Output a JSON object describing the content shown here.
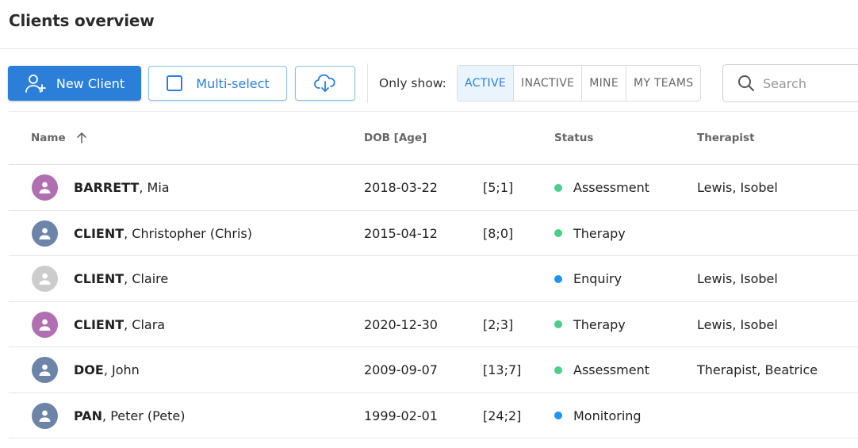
{
  "page": {
    "title": "Clients overview"
  },
  "toolbar": {
    "new_client_label": "New Client",
    "multi_select_label": "Multi-select",
    "only_show_label": "Only show:",
    "filters": [
      {
        "label": "ACTIVE",
        "active": true
      },
      {
        "label": "INACTIVE",
        "active": false
      },
      {
        "label": "MINE",
        "active": false
      },
      {
        "label": "MY TEAMS",
        "active": false
      }
    ],
    "search_placeholder": "Search"
  },
  "table": {
    "columns": {
      "name": "Name",
      "dob": "DOB [Age]",
      "status": "Status",
      "therapist": "Therapist"
    },
    "sort": {
      "column": "name",
      "direction": "ascending"
    },
    "rows": [
      {
        "surname": "BARRETT",
        "given": ", Mia",
        "dob": "2018-03-22",
        "age": "[5;1]",
        "status": "Assessment",
        "status_color": "#4cce8b",
        "therapist": "Lewis, Isobel",
        "avatar_color": "#b06fb0"
      },
      {
        "surname": "CLIENT",
        "given": ", Christopher (Chris)",
        "dob": "2015-04-12",
        "age": "[8;0]",
        "status": "Therapy",
        "status_color": "#4cce8b",
        "therapist": "",
        "avatar_color": "#6b84a8"
      },
      {
        "surname": "CLIENT",
        "given": ", Claire",
        "dob": "",
        "age": "",
        "status": "Enquiry",
        "status_color": "#1f94f0",
        "therapist": "Lewis, Isobel",
        "avatar_color": "#cccccc"
      },
      {
        "surname": "CLIENT",
        "given": ", Clara",
        "dob": "2020-12-30",
        "age": "[2;3]",
        "status": "Therapy",
        "status_color": "#4cce8b",
        "therapist": "Lewis, Isobel",
        "avatar_color": "#b06fb0"
      },
      {
        "surname": "DOE",
        "given": ", John",
        "dob": "2009-09-07",
        "age": "[13;7]",
        "status": "Assessment",
        "status_color": "#4cce8b",
        "therapist": "Therapist, Beatrice",
        "avatar_color": "#6b84a8"
      },
      {
        "surname": "PAN",
        "given": ", Peter (Pete)",
        "dob": "1999-02-01",
        "age": "[24;2]",
        "status": "Monitoring",
        "status_color": "#1f94f0",
        "therapist": "",
        "avatar_color": "#6b84a8"
      }
    ]
  },
  "icons": {
    "new_client": "add-person-icon",
    "multi_select": "checkbox-icon",
    "download": "cloud-download-icon",
    "search": "search-icon",
    "sort": "arrow-up-icon",
    "avatar": "person-icon"
  }
}
